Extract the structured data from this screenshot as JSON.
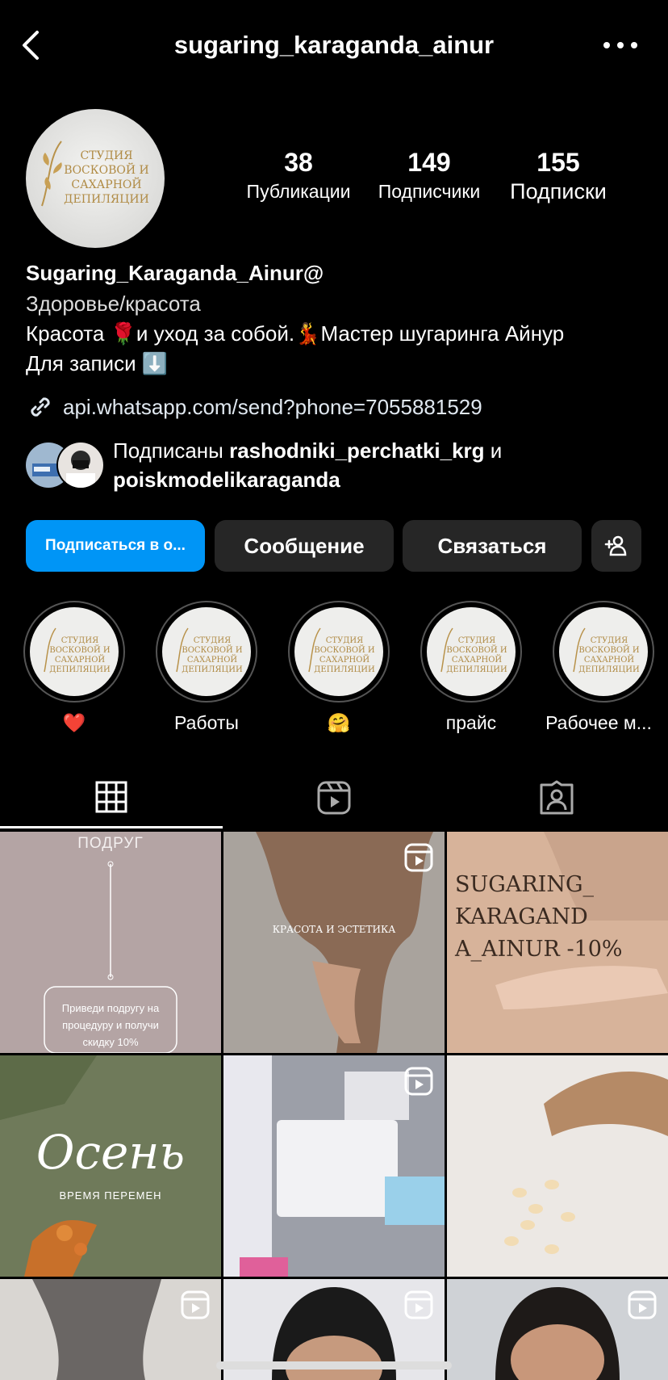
{
  "header": {
    "title": "sugaring_karaganda_ainur"
  },
  "profile": {
    "avatar_text": "СТУДИЯ ВОСКОВОЙ И САХАРНОЙ ДЕПИЛЯЦИИ",
    "stats": [
      {
        "num": "38",
        "label": "Публикации"
      },
      {
        "num": "149",
        "label": "Подписчики"
      },
      {
        "num": "155",
        "label": "Подписки"
      }
    ],
    "name": "Sugaring_Karaganda_Ainur@",
    "category": "Здоровье/красота",
    "bio_line1": "Красота 🌹и уход за собой.💃Мастер шугаринга Айнур",
    "bio_line2": "Для записи ⬇️",
    "link": "api.whatsapp.com/send?phone=7055881529"
  },
  "mutual": {
    "prefix": "Подписаны ",
    "user1": "rashodniki_perchatki_krg",
    "and": " и",
    "user2": "poiskmodelikaraganda"
  },
  "buttons": {
    "follow": "Подписаться в о...",
    "message": "Сообщение",
    "contact": "Связаться"
  },
  "highlights": [
    {
      "label": "❤️"
    },
    {
      "label": "Работы"
    },
    {
      "label": "🤗"
    },
    {
      "label": "прайс"
    },
    {
      "label": "Рабочее м..."
    }
  ],
  "grid_texts": {
    "p1_title": "ПОДРУГ",
    "p1_box": "Приведи подругу на процедуру и получи скидку 10%",
    "p2": "КРАСОТА И ЭСТЕТИКА",
    "p3": "SUGARING_ KARAGAND A_AINUR -10%",
    "p4_big": "Осень",
    "p4_small": "ВРЕМЯ ПЕРЕМЕН"
  },
  "colors": {
    "accent": "#0095f6",
    "button": "#262626",
    "background": "#000000"
  }
}
